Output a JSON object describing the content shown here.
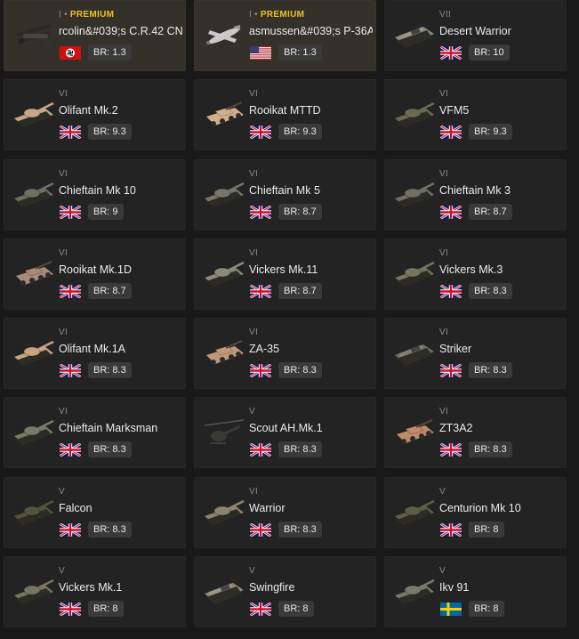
{
  "vehicles": [
    {
      "rank": "I",
      "premium": true,
      "premium_label": "PREMIUM",
      "name": "rcolin&#039;s C.R.42 CN",
      "br": "BR: 1.3",
      "flag": "germany",
      "type": "biplane",
      "color": "#2a2a2a"
    },
    {
      "rank": "I",
      "premium": true,
      "premium_label": "PREMIUM",
      "name": "asmussen&#039;s P-36A",
      "br": "BR: 1.3",
      "flag": "usa",
      "type": "plane",
      "color": "#c9c9c9"
    },
    {
      "rank": "VII",
      "premium": false,
      "name": "Desert Warrior",
      "br": "BR: 10",
      "flag": "uk",
      "type": "ifv",
      "color": "#8a8a78"
    },
    {
      "rank": "VI",
      "premium": false,
      "name": "Olifant Mk.2",
      "br": "BR: 9.3",
      "flag": "uk",
      "type": "tank",
      "color": "#c8a68a"
    },
    {
      "rank": "VI",
      "premium": false,
      "name": "Rooikat MTTD",
      "br": "BR: 9.3",
      "flag": "uk",
      "type": "wheeled",
      "color": "#d2ae8c"
    },
    {
      "rank": "VI",
      "premium": false,
      "name": "VFM5",
      "br": "BR: 9.3",
      "flag": "uk",
      "type": "tank",
      "color": "#6b6a55"
    },
    {
      "rank": "VI",
      "premium": false,
      "name": "Chieftain Mk 10",
      "br": "BR: 9",
      "flag": "uk",
      "type": "tank",
      "color": "#6f7060"
    },
    {
      "rank": "VI",
      "premium": false,
      "name": "Chieftain Mk 5",
      "br": "BR: 8.7",
      "flag": "uk",
      "type": "tank",
      "color": "#76766a"
    },
    {
      "rank": "VI",
      "premium": false,
      "name": "Chieftain Mk 3",
      "br": "BR: 8.7",
      "flag": "uk",
      "type": "tank",
      "color": "#707064"
    },
    {
      "rank": "VI",
      "premium": false,
      "name": "Rooikat Mk.1D",
      "br": "BR: 8.7",
      "flag": "uk",
      "type": "wheeled",
      "color": "#a88a7a"
    },
    {
      "rank": "VI",
      "premium": false,
      "name": "Vickers Mk.11",
      "br": "BR: 8.7",
      "flag": "uk",
      "type": "tank",
      "color": "#8a8a7a"
    },
    {
      "rank": "VI",
      "premium": false,
      "name": "Vickers Mk.3",
      "br": "BR: 8.3",
      "flag": "uk",
      "type": "tank",
      "color": "#74745f"
    },
    {
      "rank": "VI",
      "premium": false,
      "name": "Olifant Mk.1A",
      "br": "BR: 8.3",
      "flag": "uk",
      "type": "tank",
      "color": "#c9a27e"
    },
    {
      "rank": "VI",
      "premium": false,
      "name": "ZA-35",
      "br": "BR: 8.3",
      "flag": "uk",
      "type": "wheeled",
      "color": "#c09a78"
    },
    {
      "rank": "VI",
      "premium": false,
      "name": "Striker",
      "br": "BR: 8.3",
      "flag": "uk",
      "type": "ifv",
      "color": "#6e6e5a"
    },
    {
      "rank": "VI",
      "premium": false,
      "name": "Chieftain Marksman",
      "br": "BR: 8.3",
      "flag": "uk",
      "type": "tank",
      "color": "#7a7a68"
    },
    {
      "rank": "V",
      "premium": false,
      "name": "Scout AH.Mk.1",
      "br": "BR: 8.3",
      "flag": "uk",
      "type": "heli",
      "color": "#3a3a32"
    },
    {
      "rank": "VI",
      "premium": false,
      "name": "ZT3A2",
      "br": "BR: 8.3",
      "flag": "uk",
      "type": "wheeled",
      "color": "#c08a6a"
    },
    {
      "rank": "V",
      "premium": false,
      "name": "Falcon",
      "br": "BR: 8.3",
      "flag": "uk",
      "type": "tank",
      "color": "#55553f"
    },
    {
      "rank": "VI",
      "premium": false,
      "name": "Warrior",
      "br": "BR: 8.3",
      "flag": "uk",
      "type": "tank",
      "color": "#8c8670"
    },
    {
      "rank": "V",
      "premium": false,
      "name": "Centurion Mk 10",
      "br": "BR: 8",
      "flag": "uk",
      "type": "tank",
      "color": "#5e5e48"
    },
    {
      "rank": "V",
      "premium": false,
      "name": "Vickers Mk.1",
      "br": "BR: 8",
      "flag": "uk",
      "type": "tank",
      "color": "#767662"
    },
    {
      "rank": "V",
      "premium": false,
      "name": "Swingfire",
      "br": "BR: 8",
      "flag": "uk",
      "type": "ifv",
      "color": "#8e8670"
    },
    {
      "rank": "V",
      "premium": false,
      "name": "Ikv 91",
      "br": "BR: 8",
      "flag": "sweden",
      "type": "tank",
      "color": "#7a7a6a"
    }
  ]
}
